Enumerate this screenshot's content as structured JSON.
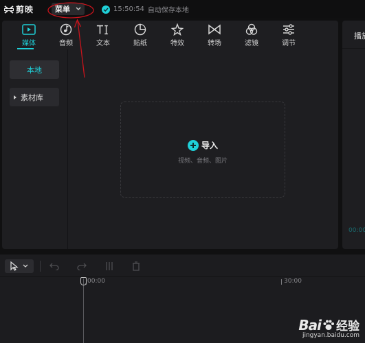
{
  "app": {
    "name": "剪映"
  },
  "topbar": {
    "menu_label": "菜单",
    "save_time": "15:50:54",
    "save_text": "自动保存本地"
  },
  "media_panel": {
    "tabs": [
      {
        "label": "媒体",
        "icon": "media-icon",
        "active": true
      },
      {
        "label": "音频",
        "icon": "audio-icon",
        "active": false
      },
      {
        "label": "文本",
        "icon": "text-icon",
        "active": false
      },
      {
        "label": "贴纸",
        "icon": "sticker-icon",
        "active": false
      },
      {
        "label": "特效",
        "icon": "effects-icon",
        "active": false
      },
      {
        "label": "转场",
        "icon": "transition-icon",
        "active": false
      },
      {
        "label": "滤镜",
        "icon": "filter-icon",
        "active": false
      },
      {
        "label": "调节",
        "icon": "adjust-icon",
        "active": false
      }
    ],
    "sidebar": [
      {
        "label": "本地",
        "active": true
      },
      {
        "label": "素材库",
        "active": false
      }
    ],
    "import": {
      "label": "导入",
      "hint": "视频、音频、图片"
    }
  },
  "player": {
    "title": "播放器",
    "time": "00:00"
  },
  "timeline": {
    "ticks": [
      "00:00",
      "30:00"
    ]
  },
  "watermark": {
    "brand": "Bai",
    "suffix": "经验",
    "url": "jingyan.baidu.com"
  },
  "colors": {
    "accent": "#1fd0d8",
    "annotation": "#c8141c"
  }
}
